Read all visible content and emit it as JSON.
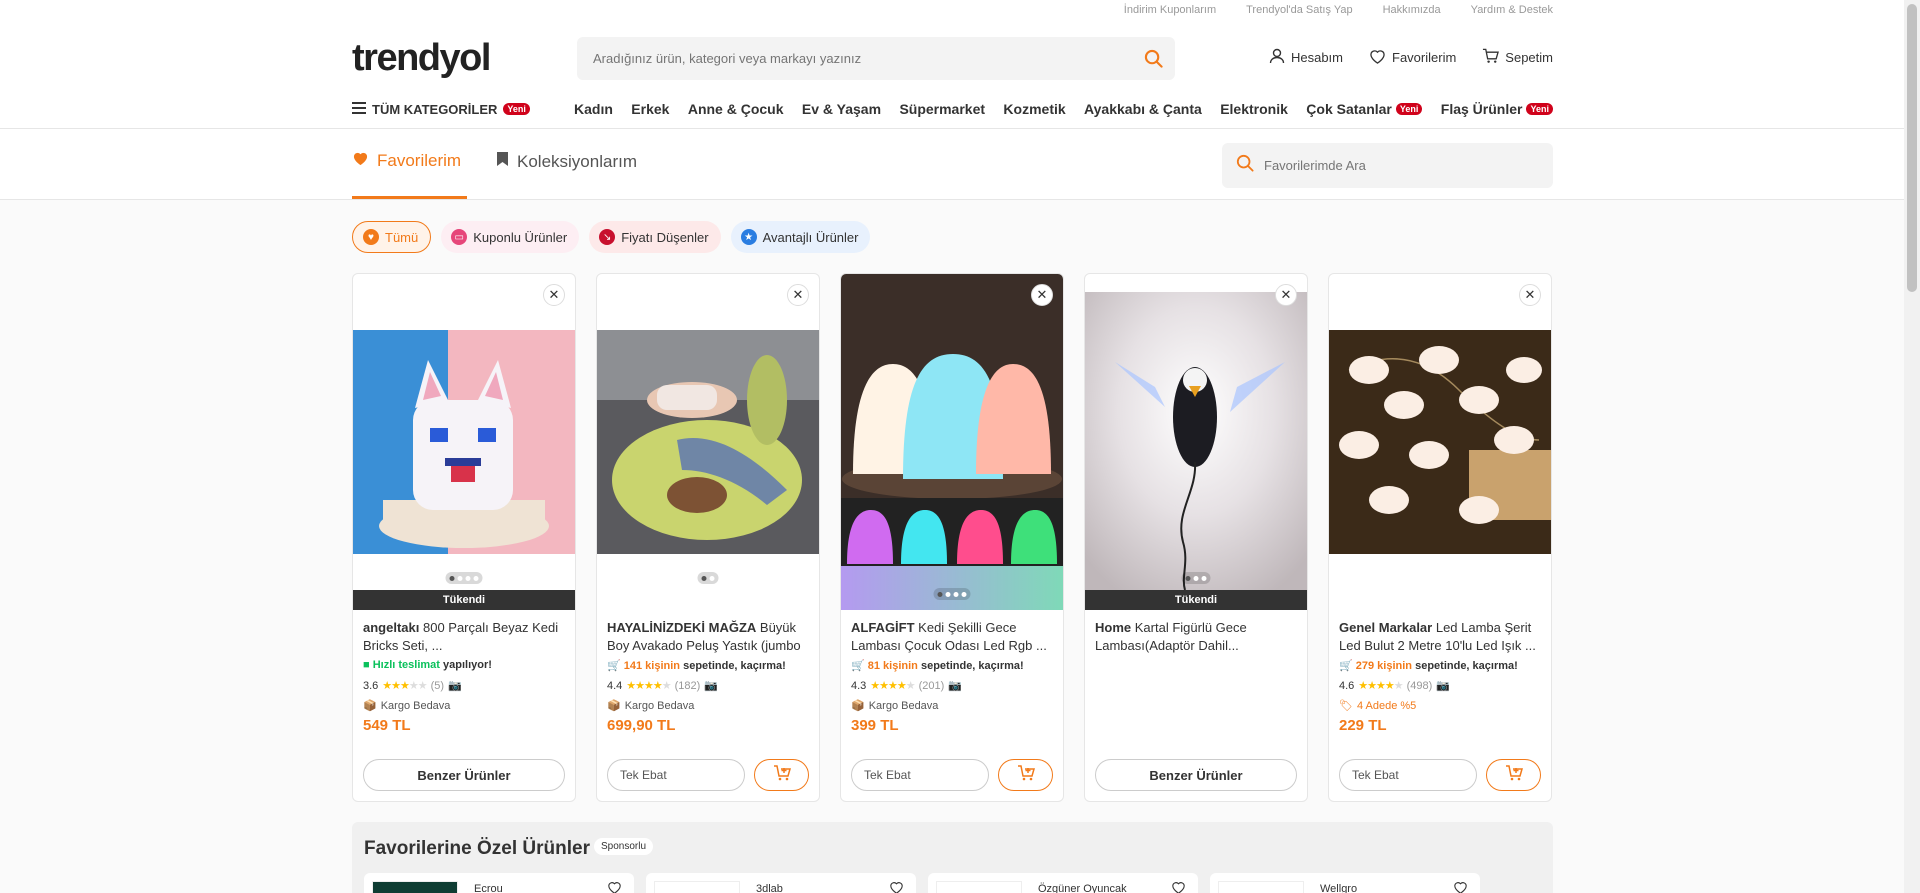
{
  "toplinks": [
    "İndirim Kuponlarım",
    "Trendyol'da Satış Yap",
    "Hakkımızda",
    "Yardım & Destek"
  ],
  "logo": "trendyol",
  "search": {
    "placeholder": "Aradığınız ürün, kategori veya markayı yazınız"
  },
  "user_actions": {
    "account": "Hesabım",
    "favorites": "Favorilerim",
    "cart": "Sepetim"
  },
  "categories": {
    "all_label": "TÜM KATEGORİLER",
    "new_badge": "Yeni",
    "items": [
      "Kadın",
      "Erkek",
      "Anne & Çocuk",
      "Ev & Yaşam",
      "Süpermarket",
      "Kozmetik",
      "Ayakkabı & Çanta",
      "Elektronik",
      "Çok Satanlar",
      "Flaş Ürünler"
    ]
  },
  "favbar": {
    "favorites_tab": "Favorilerim",
    "collections_tab": "Koleksiyonlarım",
    "search_placeholder": "Favorilerimde Ara"
  },
  "chips": [
    "Tümü",
    "Kuponlu Ürünler",
    "Fiyatı Düşenler",
    "Avantajlı Ürünler"
  ],
  "products": [
    {
      "brand": "angeltakı",
      "name": "800 Parçalı Beyaz Kedi Bricks Seti, ...",
      "promo_pre": "",
      "promo_highlight": "Hızlı teslimat",
      "promo_post": " yapılıyor!",
      "rating": "3.6",
      "count": "(5)",
      "kargo": "Kargo Bedava",
      "price": "549 TL",
      "soldout": "Tükendi",
      "action": "Benzer Ürünler",
      "stars": 3.6
    },
    {
      "brand": "HAYALİNİZDEKİ MAĞZA",
      "name": "Büyük Boy Avakado Peluş Yastık (jumbo Boy)",
      "promo_highlight": "141 kişinin",
      "promo_post": " sepetinde, kaçırma!",
      "rating": "4.4",
      "count": "(182)",
      "kargo": "Kargo Bedava",
      "price": "699,90 TL",
      "ebat": "Tek Ebat",
      "stars": 4.4
    },
    {
      "brand": "ALFAGİFT",
      "name": "Kedi Şekilli Gece Lambası Çocuk Odası Led Rgb ...",
      "promo_highlight": "81 kişinin",
      "promo_post": " sepetinde, kaçırma!",
      "rating": "4.3",
      "count": "(201)",
      "kargo": "Kargo Bedava",
      "price": "399 TL",
      "ebat": "Tek Ebat",
      "stars": 4.3
    },
    {
      "brand": "Home",
      "name": "Kartal Figürlü Gece Lambası(Adaptör Dahil...",
      "soldout": "Tükendi",
      "action": "Benzer Ürünler"
    },
    {
      "brand": "Genel Markalar",
      "name": "Led Lamba Şerit Led Bulut 2 Metre 10'lu Led Işık ...",
      "promo_highlight": "279 kişinin",
      "promo_post": " sepetinde, kaçırma!",
      "rating": "4.6",
      "count": "(498)",
      "adede": "4 Adede %5",
      "price": "229 TL",
      "ebat": "Tek Ebat",
      "stars": 4.6
    }
  ],
  "recs": {
    "title": "Favorilerine Özel Ürünler",
    "sponsored": "Sponsorlu",
    "items": [
      "Ecrou",
      "3dlab",
      "Özgüner Oyuncak",
      "Wellgro"
    ]
  },
  "colors": {
    "brand": "#f27a1a",
    "badge": "#d0021b"
  }
}
